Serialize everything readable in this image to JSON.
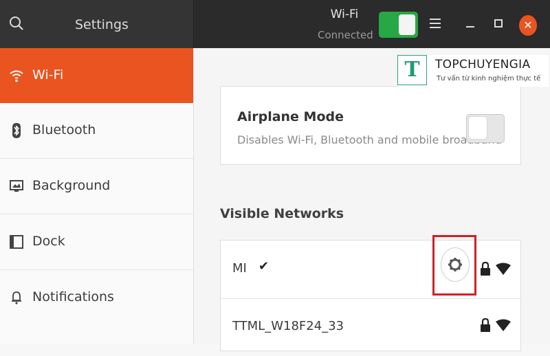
{
  "header": {
    "app_title": "Settings",
    "panel_title": "Wi-Fi",
    "panel_status": "Connected",
    "wifi_switch_on": true,
    "icons": [
      "search-icon",
      "menu-icon",
      "minimize-icon",
      "maximize-icon",
      "close-icon"
    ]
  },
  "sidebar": {
    "items": [
      {
        "label": "Wi-Fi",
        "icon": "wifi-icon",
        "active": true
      },
      {
        "label": "Bluetooth",
        "icon": "bluetooth-icon",
        "active": false
      },
      {
        "label": "Background",
        "icon": "background-icon",
        "active": false
      },
      {
        "label": "Dock",
        "icon": "dock-icon",
        "active": false
      },
      {
        "label": "Notifications",
        "icon": "bell-icon",
        "active": false
      }
    ]
  },
  "airplane": {
    "title": "Airplane Mode",
    "description": "Disables Wi-Fi, Bluetooth and mobile broadband",
    "enabled": false
  },
  "networks": {
    "section_title": "Visible Networks",
    "items": [
      {
        "name": "MI",
        "connected": true,
        "secured": true,
        "has_settings": true
      },
      {
        "name": "TTML_W18F24_33",
        "connected": false,
        "secured": true,
        "has_settings": false
      }
    ]
  },
  "watermark": {
    "logo_letter": "T",
    "brand": "TOPCHUYENGIA",
    "slogan": "Tư vấn từ kinh nghiệm thực tế"
  },
  "colors": {
    "accent": "#e95420",
    "switch_on": "#28a745",
    "highlight_box": "#d21f26",
    "watermark": "#1f9d6e"
  }
}
